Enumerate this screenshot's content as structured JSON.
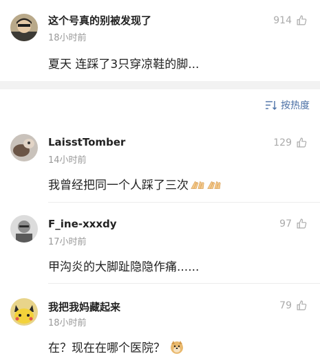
{
  "top_comment": {
    "username": "这个号真的别被发现了",
    "time": "18小时前",
    "likes": "914",
    "text": "夏天 连踩了3只穿凉鞋的脚..."
  },
  "sort": {
    "label": "按热度",
    "icon": "sort-icon"
  },
  "comments": [
    {
      "username": "LaisstTomber",
      "time": "14小时前",
      "likes": "129",
      "text": "我曾经把同一个人踩了三次",
      "emoji": "clap-hands-icon"
    },
    {
      "username": "F_ine-xxxdy",
      "time": "17小时前",
      "likes": "97",
      "text": "甲沟炎的大脚趾隐隐作痛......"
    },
    {
      "username": "我把我妈藏起来",
      "time": "18小时前",
      "likes": "79",
      "text": "在？现在在哪个医院？",
      "emoji": "doge-icon"
    }
  ],
  "colors": {
    "accent": "#4a6fa5",
    "muted": "#999999",
    "gap": "#f2f2f2"
  }
}
